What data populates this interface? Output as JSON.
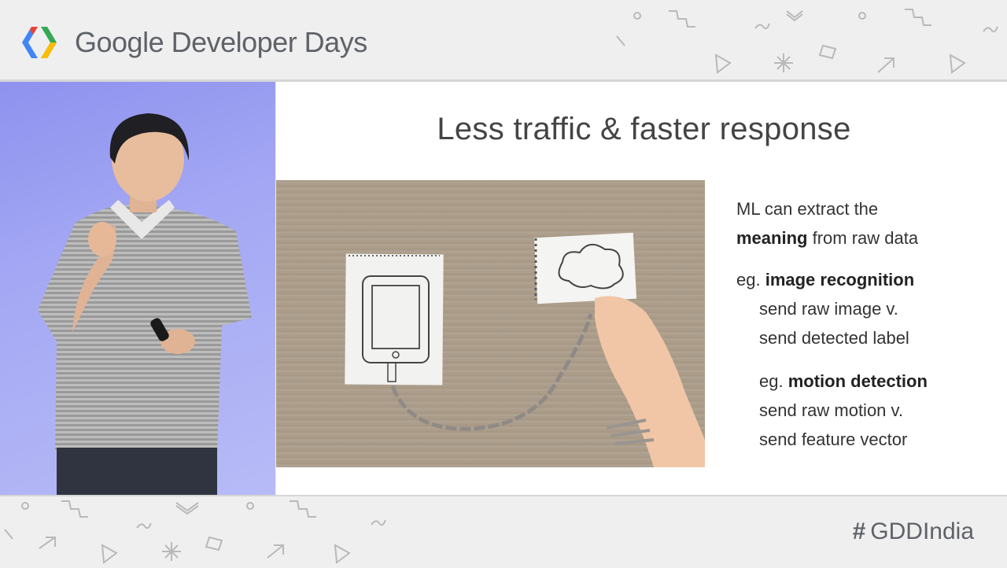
{
  "header": {
    "brand": "Google Developer Days"
  },
  "slide": {
    "title": "Less traffic & faster response",
    "lines": {
      "ml_1": "ML can extract the",
      "ml_2_bold": "meaning",
      "ml_2_rest": " from raw data",
      "eg1_prefix": "eg. ",
      "eg1_bold": "image recognition",
      "eg1_line2": "send raw image v.",
      "eg1_line3": "send detected label",
      "eg2_prefix": "eg. ",
      "eg2_bold": "motion detection",
      "eg2_line2": "send raw motion v.",
      "eg2_line3": "send feature vector"
    }
  },
  "footer": {
    "hashtag_symbol": "#",
    "hashtag_text": "GDDIndia"
  },
  "colors": {
    "logo_blue": "#4285f4",
    "logo_red": "#ea4335",
    "logo_green": "#34a853",
    "logo_yellow": "#fbbc05",
    "speaker_bg": "#a4a8f4"
  },
  "icons": [
    "gdd-logo-icon",
    "doodle-icons",
    "hashtag-icon"
  ]
}
